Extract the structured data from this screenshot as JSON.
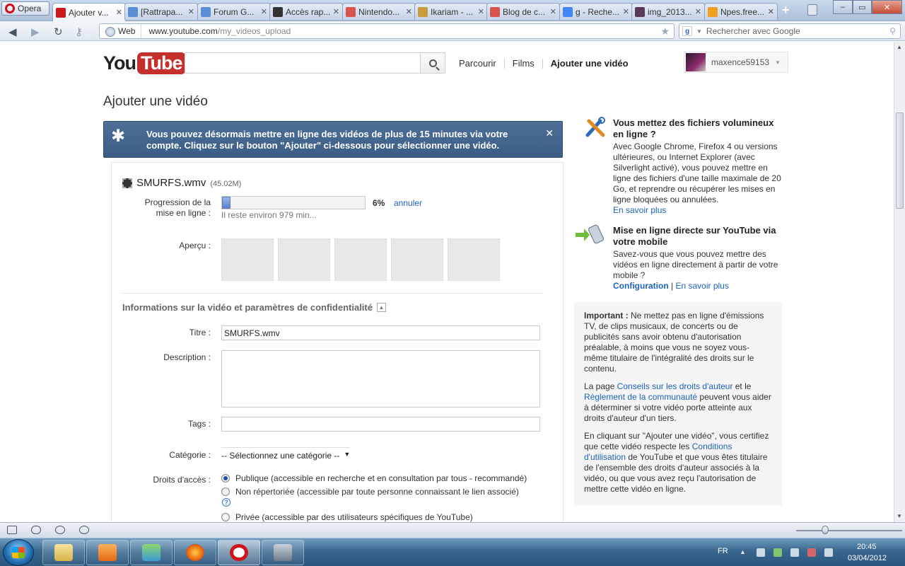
{
  "browser": {
    "opera_label": "Opera",
    "tabs": [
      {
        "label": "Ajouter v...",
        "icon": "youtube-icon",
        "color": "#cc181e"
      },
      {
        "label": "[Rattrapa...",
        "icon": "forum-icon",
        "color": "#5a8fd6"
      },
      {
        "label": "Forum G...",
        "icon": "forum-icon",
        "color": "#5a8fd6"
      },
      {
        "label": "Accès rap...",
        "icon": "speed-dial-icon",
        "color": "#333333"
      },
      {
        "label": "Nintendo...",
        "icon": "nm-icon",
        "color": "#d9534f"
      },
      {
        "label": "Ikariam - ...",
        "icon": "ikariam-icon",
        "color": "#c89b3c"
      },
      {
        "label": "Blog de c...",
        "icon": "nm-icon",
        "color": "#d9534f"
      },
      {
        "label": "g - Reche...",
        "icon": "google-icon",
        "color": "#4285f4"
      },
      {
        "label": "img_2013...",
        "icon": "image-icon",
        "color": "#5a3a5a"
      },
      {
        "label": "Npes.free...",
        "icon": "free-icon",
        "color": "#f0a020"
      }
    ],
    "address": {
      "scheme_label": "Web",
      "url_host": "www.youtube.com",
      "url_path": "/my_videos_upload"
    },
    "search_placeholder": "Rechercher avec Google"
  },
  "header": {
    "logo_you": "You",
    "logo_tube": "Tube",
    "nav": [
      "Parcourir",
      "Films",
      "Ajouter une vidéo"
    ],
    "username": "maxence59153"
  },
  "page": {
    "title": "Ajouter une vidéo",
    "banner": "Vous pouvez désormais mettre en ligne des vidéos de plus de 15 minutes via votre compte. Cliquez sur le bouton \"Ajouter\" ci-dessous pour sélectionner une vidéo.",
    "banner_close": "✕"
  },
  "upload": {
    "file_name": "SMURFS.wmv",
    "file_size": "(45.02M)",
    "progress_label": "Progression de la mise en ligne :",
    "progress_percent": 6,
    "progress_text": "6%",
    "cancel_label": "annuler",
    "remaining": "Il reste environ 979 min...",
    "preview_label": "Aperçu :",
    "thumb_count": 5
  },
  "info": {
    "section_title": "Informations sur la vidéo et paramètres de confidentialité",
    "title_label": "Titre :",
    "title_value": "SMURFS.wmv",
    "description_label": "Description :",
    "description_value": "",
    "tags_label": "Tags :",
    "tags_value": "",
    "category_label": "Catégorie :",
    "category_value": "-- Sélectionnez une catégorie --",
    "access_label": "Droits d'accès :",
    "access_options": [
      {
        "label": "Publique (accessible en recherche et en consultation par tous - recommandé)",
        "checked": true
      },
      {
        "label": "Non répertoriée (accessible par toute personne connaissant le lien associé)",
        "checked": false
      },
      {
        "label": "Privée (accessible par des utilisateurs spécifiques de YouTube)",
        "checked": false
      }
    ]
  },
  "sidebar": {
    "large_files": {
      "title": "Vous mettez des fichiers volumineux en ligne ?",
      "body": "Avec Google Chrome, Firefox 4 ou versions ultérieures, ou Internet Explorer (avec Silverlight activé), vous pouvez mettre en ligne des fichiers d'une taille maximale de 20 Go, et reprendre ou récupérer les mises en ligne bloquées ou annulées.",
      "link": "En savoir plus"
    },
    "mobile": {
      "title": "Mise en ligne directe sur YouTube via votre mobile",
      "body": "Savez-vous que vous pouvez mettre des vidéos en ligne directement à partir de votre mobile ?",
      "link1": "Configuration",
      "sep": "|",
      "link2": "En savoir plus"
    },
    "legal": {
      "important_label": "Important :",
      "important_text": " Ne mettez pas en ligne d'émissions TV, de clips musicaux, de concerts ou de publicités sans avoir obtenu d'autorisation préalable, à moins que vous ne soyez vous-même titulaire de l'intégralité des droits sur le contenu.",
      "p2_a": "La page ",
      "p2_link1": "Conseils sur les droits d'auteur",
      "p2_b": " et le ",
      "p2_link2": "Règlement de la communauté",
      "p2_c": " peuvent vous aider à déterminer si votre vidéo porte atteinte aux droits d'auteur d'un tiers.",
      "p3_a": "En cliquant sur \"Ajouter une vidéo\", vous certifiez que cette vidéo respecte les ",
      "p3_link": "Conditions d'utilisation",
      "p3_b": " de YouTube et que vous êtes titulaire de l'ensemble des droits d'auteur associés à la vidéo, ou que vous avez reçu l'autorisation de mettre cette vidéo en ligne."
    }
  },
  "taskbar": {
    "lang": "FR",
    "time": "20:45",
    "date": "03/04/2012"
  }
}
